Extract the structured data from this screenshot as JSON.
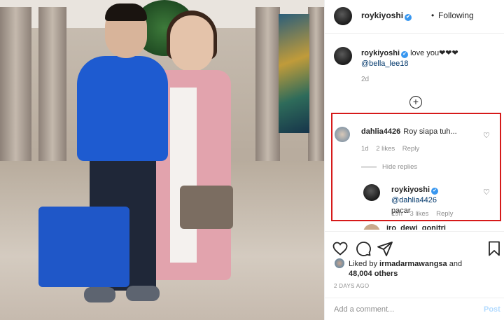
{
  "post": {
    "author": "roykiyoshi",
    "follow_status": "Following",
    "separator": "•",
    "verified_badge": "✔",
    "caption": {
      "text": "love you❤❤❤",
      "mention": "@bella_lee18",
      "time": "2d"
    },
    "load_more_icon": "plus-circle-icon",
    "comments": [
      {
        "username": "dahlia4426",
        "text": "Roy siapa tuh...",
        "time": "1d",
        "likes": "2 likes",
        "reply_label": "Reply",
        "hide_replies": "Hide replies",
        "replies": [
          {
            "username": "roykiyoshi",
            "mention": "@dahlia4426",
            "text": "pacar",
            "time": "19h",
            "likes": "3 likes",
            "reply_label": "Reply"
          }
        ]
      },
      {
        "username": "iro_dewi_gonitri"
      }
    ],
    "heart_glyph": "♡",
    "actions": {
      "like_icon": "heart-icon",
      "comment_icon": "comment-icon",
      "share_icon": "paper-plane-icon",
      "save_icon": "bookmark-icon"
    },
    "liked_by": {
      "prefix": "Liked by",
      "user": "irmadarmawangsa",
      "and": "and",
      "others": "48,004 others"
    },
    "time_ago": "2 DAYS AGO",
    "comment_input": {
      "placeholder": "Add a comment...",
      "post_label": "Post"
    },
    "highlight_color": "#d61a1a",
    "link_color": "#00376b",
    "verified_color": "#3897f0"
  }
}
